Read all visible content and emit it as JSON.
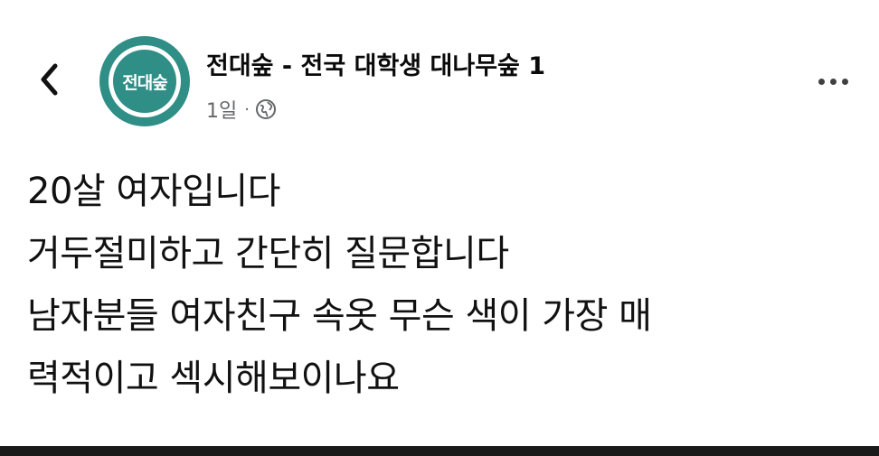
{
  "header": {
    "page_name": "전대숲 - 전국 대학생 대나무숲 1",
    "avatar_text": "전대숲",
    "timestamp": "1일",
    "separator": "·",
    "privacy_icon": "globe-icon",
    "back_icon": "chevron-left-icon",
    "more_icon": "more-horizontal-icon"
  },
  "post": {
    "lines": [
      "20살 여자입니다",
      "거두절미하고 간단히 질문합니다",
      "남자분들 여자친구 속옷 무슨 색이 가장 매",
      "력적이고 섹시해보이나요"
    ]
  },
  "colors": {
    "avatar": "#2f8e86",
    "meta_text": "#65676b",
    "bottom_bar": "#1a1a1a"
  }
}
